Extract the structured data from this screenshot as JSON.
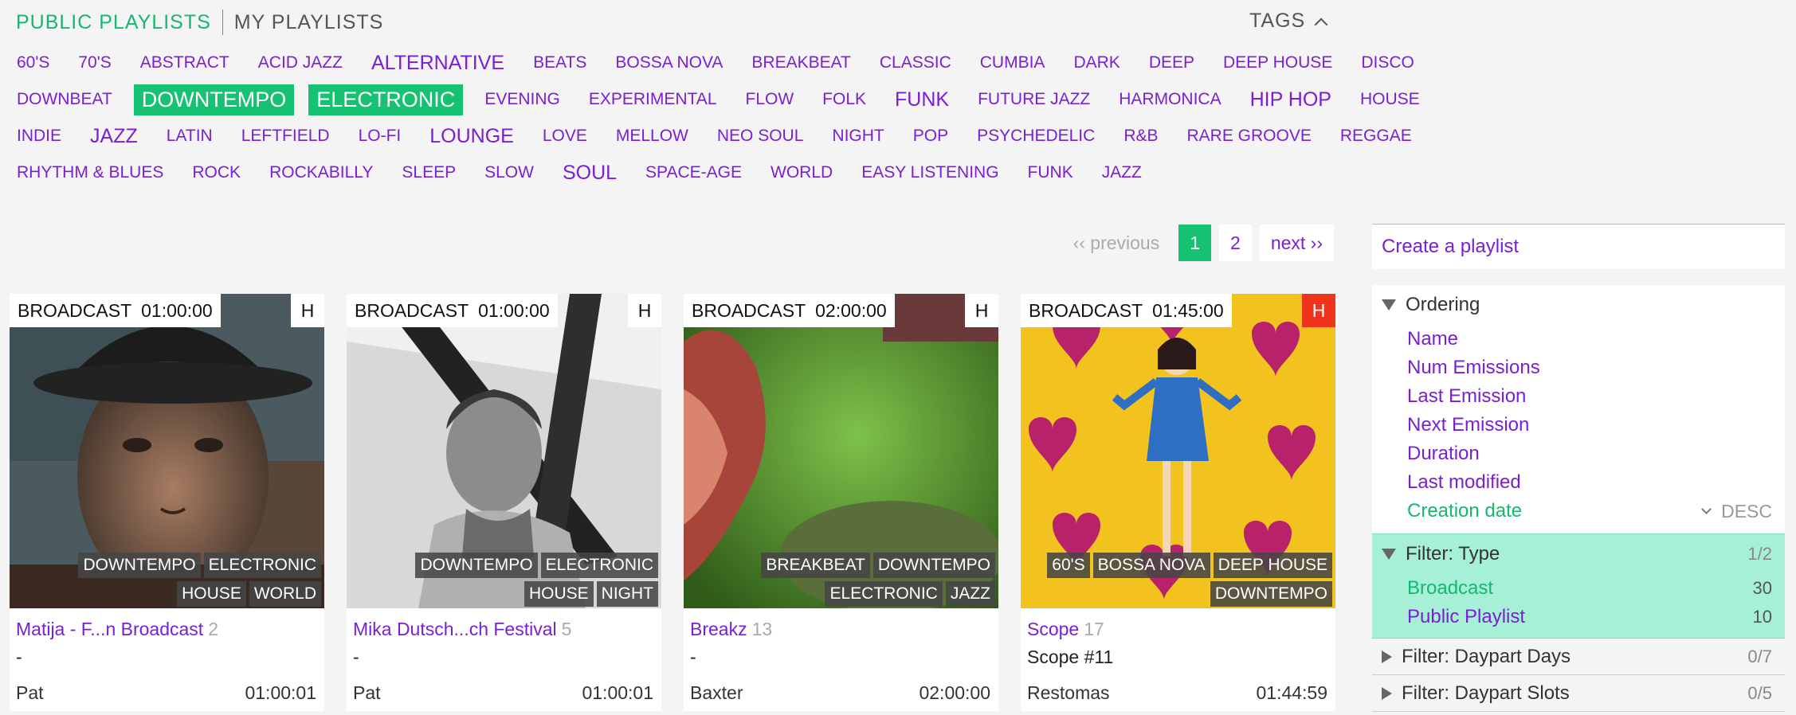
{
  "tabs": {
    "public": "PUBLIC PLAYLISTS",
    "mine": "MY PLAYLISTS",
    "tags_label": "TAGS"
  },
  "tag_rows": [
    [
      {
        "t": "60'S"
      },
      {
        "t": "70'S"
      },
      {
        "t": "ABSTRACT"
      },
      {
        "t": "ACID JAZZ"
      },
      {
        "t": "ALTERNATIVE",
        "l": 1
      },
      {
        "t": "BEATS"
      },
      {
        "t": "BOSSA NOVA"
      },
      {
        "t": "BREAKBEAT"
      },
      {
        "t": "CLASSIC"
      },
      {
        "t": "CUMBIA"
      },
      {
        "t": "DARK"
      },
      {
        "t": "DEEP"
      },
      {
        "t": "DEEP HOUSE"
      },
      {
        "t": "DISCO"
      }
    ],
    [
      {
        "t": "DOWNBEAT"
      },
      {
        "t": "DOWNTEMPO",
        "on": 1
      },
      {
        "t": "ELECTRONIC",
        "on": 1
      },
      {
        "t": "EVENING"
      },
      {
        "t": "EXPERIMENTAL"
      },
      {
        "t": "FLOW"
      },
      {
        "t": "FOLK"
      },
      {
        "t": "FUNK",
        "l": 1
      },
      {
        "t": "FUTURE JAZZ"
      },
      {
        "t": "HARMONICA"
      },
      {
        "t": "HIP HOP",
        "l": 1
      },
      {
        "t": "HOUSE"
      }
    ],
    [
      {
        "t": "INDIE"
      },
      {
        "t": "JAZZ",
        "l": 1
      },
      {
        "t": "LATIN"
      },
      {
        "t": "LEFTFIELD"
      },
      {
        "t": "LO-FI"
      },
      {
        "t": "LOUNGE",
        "l": 1
      },
      {
        "t": "LOVE"
      },
      {
        "t": "MELLOW"
      },
      {
        "t": "NEO SOUL"
      },
      {
        "t": "NIGHT"
      },
      {
        "t": "POP"
      },
      {
        "t": "PSYCHEDELIC"
      },
      {
        "t": "R&B"
      },
      {
        "t": "RARE GROOVE"
      },
      {
        "t": "REGGAE"
      }
    ],
    [
      {
        "t": "RHYTHM & BLUES"
      },
      {
        "t": "ROCK"
      },
      {
        "t": "ROCKABILLY"
      },
      {
        "t": "SLEEP"
      },
      {
        "t": "SLOW"
      },
      {
        "t": "SOUL",
        "l": 1
      },
      {
        "t": "SPACE-AGE"
      },
      {
        "t": "WORLD"
      },
      {
        "t": "EASY LISTENING"
      },
      {
        "t": "FUNK"
      },
      {
        "t": "JAZZ"
      }
    ]
  ],
  "pager": {
    "previous": "‹‹ previous",
    "p1": "1",
    "p2": "2",
    "next": "next ››"
  },
  "cards": [
    {
      "type": "BROADCAST",
      "dur": "01:00:00",
      "badge": "H",
      "title": "Matija - F...n Broadcast",
      "count": "2",
      "sub": "-",
      "author": "Pat",
      "length": "01:00:01",
      "tags": [
        [
          "DOWNTEMPO",
          "ELECTRONIC"
        ],
        [
          "HOUSE",
          "WORLD"
        ]
      ]
    },
    {
      "type": "BROADCAST",
      "dur": "01:00:00",
      "badge": "H",
      "title": "Mika Dutsch...ch Festival",
      "count": "5",
      "sub": "-",
      "author": "Pat",
      "length": "01:00:01",
      "tags": [
        [
          "DOWNTEMPO",
          "ELECTRONIC"
        ],
        [
          "HOUSE",
          "NIGHT"
        ]
      ]
    },
    {
      "type": "BROADCAST",
      "dur": "02:00:00",
      "badge": "H",
      "title": "Breakz",
      "count": "13",
      "sub": "-",
      "author": "Baxter",
      "length": "02:00:00",
      "tags": [
        [
          "BREAKBEAT",
          "DOWNTEMPO"
        ],
        [
          "ELECTRONIC",
          "JAZZ"
        ]
      ]
    },
    {
      "type": "BROADCAST",
      "dur": "01:45:00",
      "badge": "H",
      "title": "Scope",
      "count": "17",
      "sub": "Scope #11",
      "author": "Restomas",
      "length": "01:44:59",
      "tags": [
        [
          "60'S",
          "BOSSA NOVA",
          "DEEP HOUSE"
        ],
        [
          "DOWNTEMPO"
        ]
      ]
    }
  ],
  "sidebar": {
    "create": "Create a playlist",
    "ordering": "Ordering",
    "order_items": [
      "Name",
      "Num Emissions",
      "Last Emission",
      "Next Emission",
      "Duration",
      "Last modified",
      "Creation date"
    ],
    "desc": "DESC",
    "filter_type": "Filter: Type",
    "filter_type_frac": "1/2",
    "broadcast": "Broadcast",
    "broadcast_n": "30",
    "public_playlist": "Public Playlist",
    "public_playlist_n": "10",
    "daypart_days": "Filter: Daypart Days",
    "daypart_days_frac": "0/7",
    "daypart_slots": "Filter: Daypart Slots",
    "daypart_slots_frac": "0/5"
  },
  "colors": {
    "accent_green": "#16c172",
    "link_purple": "#7a1fd1",
    "filter_bg": "#a6f0d8",
    "red_badge": "#f0341b"
  }
}
